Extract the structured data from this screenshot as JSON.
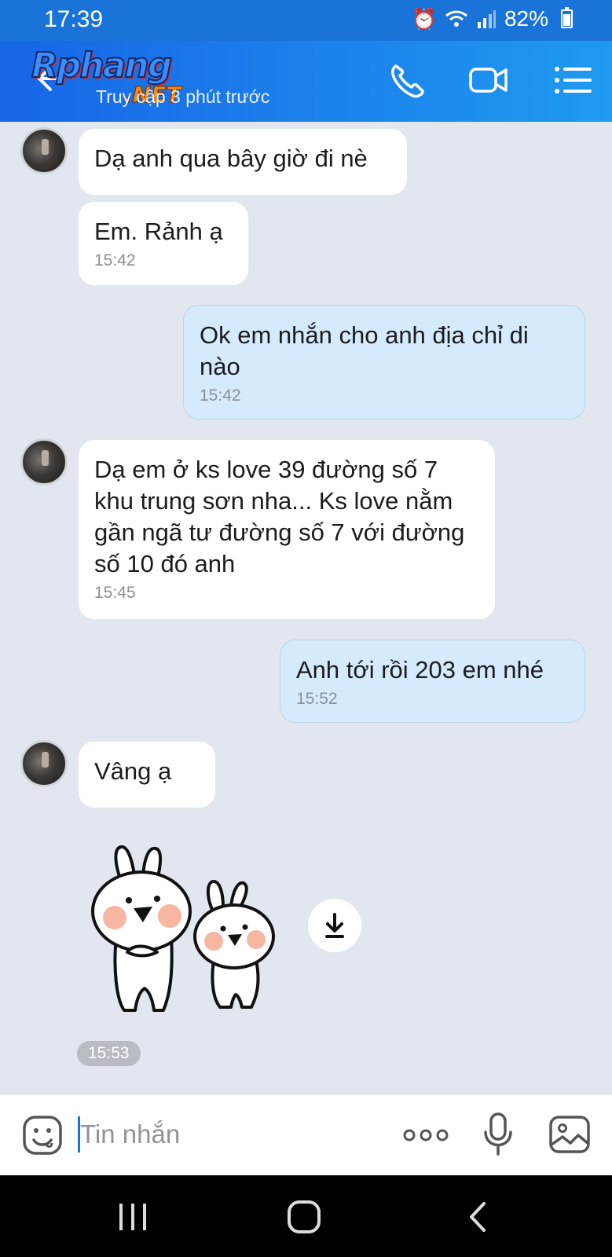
{
  "status_bar": {
    "time": "17:39",
    "battery": "82%",
    "icons": [
      "alarm-icon",
      "wifi-icon",
      "signal-icon",
      "battery-icon"
    ]
  },
  "header": {
    "logo_text": "Rphang",
    "logo_suffix": ".NET",
    "status_text": "Truy cập 3 phút trước",
    "icons": [
      "back-icon",
      "phone-icon",
      "video-icon",
      "menu-icon"
    ]
  },
  "messages": [
    {
      "direction": "incoming",
      "text": "Dạ anh qua bây giờ đi nè",
      "time": ""
    },
    {
      "direction": "incoming",
      "text": "Em. Rảnh ạ",
      "time": "15:42"
    },
    {
      "direction": "outgoing",
      "text": "Ok em nhắn cho anh địa chỉ di nào",
      "time": "15:42"
    },
    {
      "direction": "incoming",
      "text": "Dạ em ở ks love 39 đường số 7 khu trung sơn nha... Ks love nằm gần ngã tư đường số 7 với đường số 10 đó anh",
      "time": "15:45"
    },
    {
      "direction": "outgoing",
      "text": "Anh tới rồi 203 em nhé",
      "time": "15:52"
    },
    {
      "direction": "incoming",
      "text": "Vâng ạ",
      "time": ""
    }
  ],
  "sticker": {
    "time": "15:53",
    "icon": "download-icon"
  },
  "composer": {
    "placeholder": "Tin nhắn",
    "icons": [
      "emoji-icon",
      "more-icon",
      "mic-icon",
      "image-icon"
    ]
  },
  "colors": {
    "header_start": "#1866e6",
    "header_end": "#1f9af0",
    "chat_background": "#e2e7ef",
    "outgoing_bubble": "#d5ebfd",
    "incoming_bubble": "#ffffff"
  }
}
